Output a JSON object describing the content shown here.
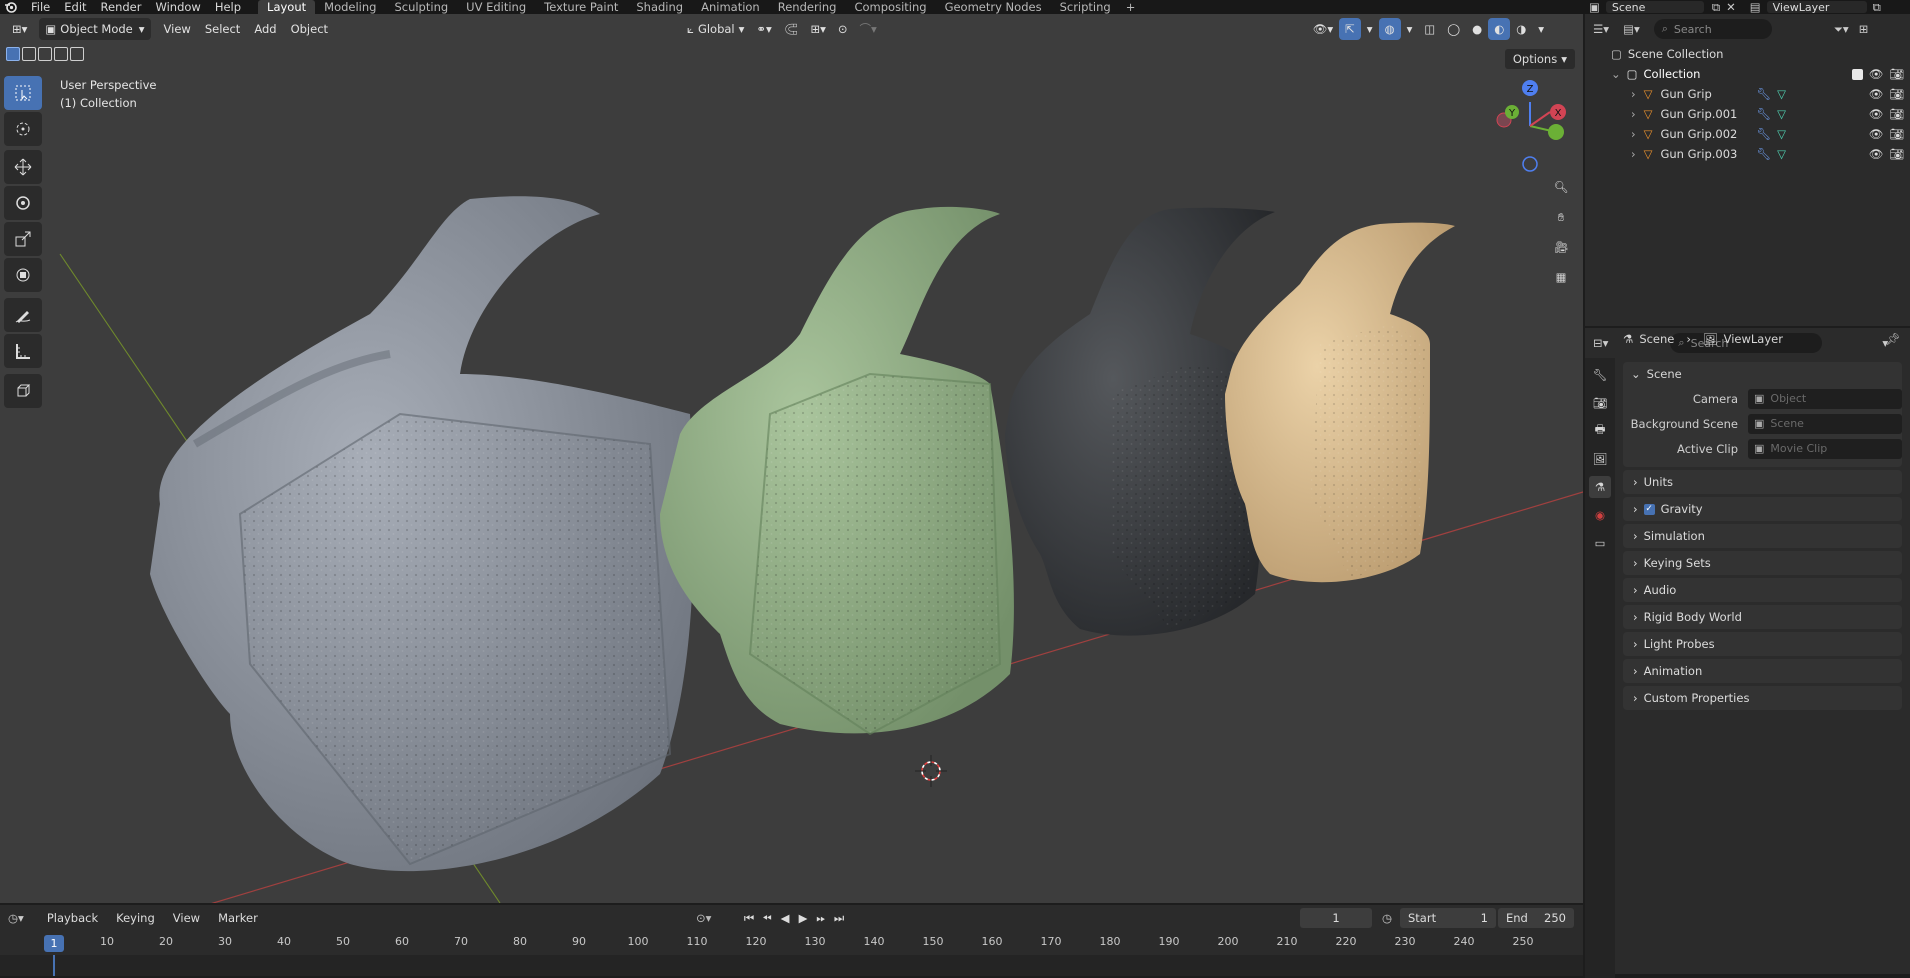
{
  "menu": [
    "File",
    "Edit",
    "Render",
    "Window",
    "Help"
  ],
  "workspaces": [
    "Layout",
    "Modeling",
    "Sculpting",
    "UV Editing",
    "Texture Paint",
    "Shading",
    "Animation",
    "Rendering",
    "Compositing",
    "Geometry Nodes",
    "Scripting",
    "+"
  ],
  "top_right": {
    "scene": "Scene",
    "view_layer": "ViewLayer"
  },
  "viewport": {
    "mode": "Object Mode",
    "menus": [
      "View",
      "Select",
      "Add",
      "Object"
    ],
    "transform_orientation": "Global",
    "options": "Options",
    "overlay_line1": "User Perspective",
    "overlay_line2": "(1) Collection",
    "gizmo": {
      "x": "X",
      "y": "Y",
      "z": "Z"
    }
  },
  "outliner": {
    "search_placeholder": "Search",
    "root": "Scene Collection",
    "collection": "Collection",
    "items": [
      "Gun Grip",
      "Gun Grip.001",
      "Gun Grip.002",
      "Gun Grip.003"
    ]
  },
  "properties": {
    "search_placeholder": "Search",
    "breadcrumb_scene": "Scene",
    "breadcrumb_viewlayer": "ViewLayer",
    "panel_title": "Scene",
    "fields": [
      {
        "label": "Camera",
        "value": "Object"
      },
      {
        "label": "Background Scene",
        "value": "Scene"
      },
      {
        "label": "Active Clip",
        "value": "Movie Clip"
      }
    ],
    "panels": [
      "Units",
      "Gravity",
      "Simulation",
      "Keying Sets",
      "Audio",
      "Rigid Body World",
      "Light Probes",
      "Animation",
      "Custom Properties"
    ]
  },
  "timeline": {
    "menus": [
      "Playback",
      "Keying",
      "View",
      "Marker"
    ],
    "current_frame": "1",
    "start_label": "Start",
    "start": "1",
    "end_label": "End",
    "end": "250",
    "frame_labels": [
      "10",
      "20",
      "30",
      "40",
      "50",
      "60",
      "70",
      "80",
      "90",
      "100",
      "110",
      "120",
      "130",
      "140",
      "150",
      "160",
      "170",
      "180",
      "190",
      "200",
      "210",
      "220",
      "230",
      "240",
      "250"
    ]
  },
  "colors": {
    "accent": "#4772b3",
    "grip_gray": "#8a909a",
    "grip_green": "#8ea681",
    "grip_black": "#3b3d40",
    "grip_tan": "#d4b88f"
  }
}
